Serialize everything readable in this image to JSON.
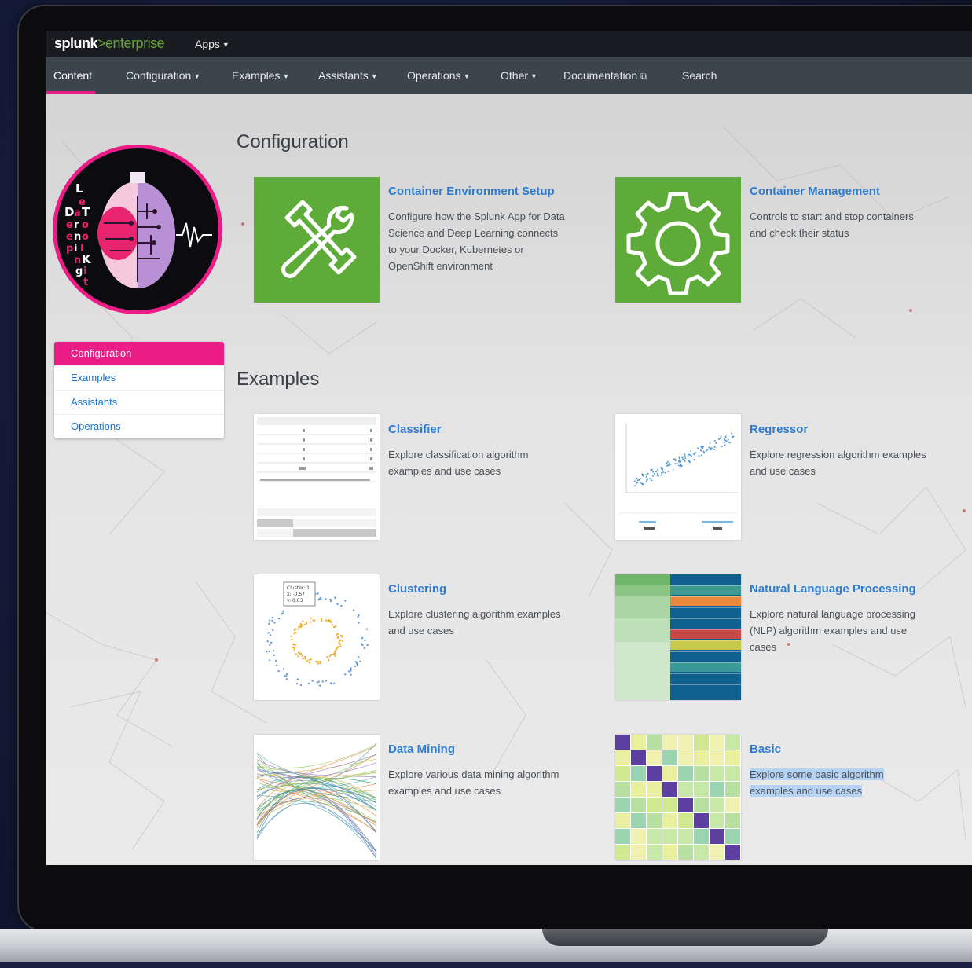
{
  "topbar": {
    "logo_main": "splunk",
    "logo_sep": ">",
    "logo_product": "enterprise",
    "apps_label": "Apps"
  },
  "nav": {
    "items": [
      {
        "label": "Content",
        "active": true
      },
      {
        "label": "Configuration",
        "dropdown": true
      },
      {
        "label": "Examples",
        "dropdown": true
      },
      {
        "label": "Assistants",
        "dropdown": true
      },
      {
        "label": "Operations",
        "dropdown": true
      },
      {
        "label": "Other",
        "dropdown": true
      },
      {
        "label": "Documentation",
        "external": true
      },
      {
        "label": "Search"
      }
    ]
  },
  "logo_letters": {
    "col1": [
      "L",
      "e",
      "a",
      "r",
      "n",
      "i",
      "n",
      "g"
    ],
    "col2": [
      "T",
      "o",
      "o",
      "l",
      "K",
      "i",
      "t"
    ],
    "d_letters": [
      "D",
      "e",
      "e",
      "p"
    ],
    "data": [
      "D",
      "a",
      "T",
      "a"
    ]
  },
  "side_menu": {
    "items": [
      {
        "label": "Configuration",
        "active": true
      },
      {
        "label": "Examples"
      },
      {
        "label": "Assistants"
      },
      {
        "label": "Operations"
      }
    ]
  },
  "sections": {
    "configuration": {
      "title": "Configuration",
      "cards": [
        {
          "title": "Container Environment Setup",
          "desc": "Configure how the Splunk App for Data Science and Deep Learning connects to your Docker, Kubernetes or OpenShift environment",
          "icon": "tools-icon"
        },
        {
          "title": "Container Management",
          "desc": "Controls to start and stop containers and check their status",
          "icon": "gear-icon"
        }
      ]
    },
    "examples": {
      "title": "Examples",
      "cards": [
        {
          "title": "Classifier",
          "desc": "Explore classification algorithm examples and use cases"
        },
        {
          "title": "Regressor",
          "desc": "Explore regression algorithm examples and use cases"
        },
        {
          "title": "Clustering",
          "desc": "Explore clustering algorithm examples and use cases"
        },
        {
          "title": "Natural Language Processing",
          "desc": "Explore natural language processing (NLP) algorithm examples and use cases"
        },
        {
          "title": "Data Mining",
          "desc": "Explore various data mining algorithm examples and use cases"
        },
        {
          "title": "Basic",
          "desc": "Explore some basic algorithm examples and use cases"
        }
      ]
    }
  },
  "thumbs": {
    "cluster_tooltip": [
      "Cluster: 1",
      "x: -0.57",
      "y: 0.83"
    ]
  },
  "colors": {
    "accent": "#ec1c86",
    "splunk_green": "#65a637",
    "tile_green": "#5eab39",
    "link_blue": "#2f7ccf",
    "nav_bg": "#3c444d"
  }
}
